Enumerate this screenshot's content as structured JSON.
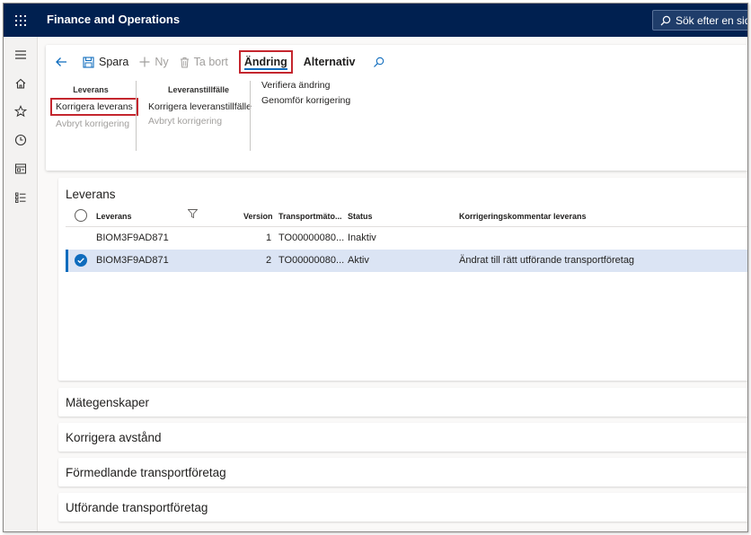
{
  "app": {
    "title": "Finance and Operations",
    "search_placeholder": "Sök efter en sida"
  },
  "nav": {
    "icons": [
      "hamburger-icon",
      "home-icon",
      "star-icon",
      "clock-icon",
      "workspace-icon",
      "list-icon"
    ]
  },
  "action_pane": {
    "save": "Spara",
    "new": "Ny",
    "delete": "Ta bort",
    "tabs": [
      "Ändring",
      "Alternativ"
    ],
    "active_tab": "Ändring",
    "groups": {
      "leverans": {
        "title": "Leverans",
        "items": [
          "Korrigera leverans",
          "Avbryt korrigering"
        ]
      },
      "leveranstillfalle": {
        "title": "Leveranstillfälle",
        "items": [
          "Korrigera leveranstillfälle",
          "Avbryt korrigering"
        ]
      },
      "ovrigt": {
        "items": [
          "Verifiera ändring",
          "Genomför korrigering"
        ]
      }
    }
  },
  "leverans_card": {
    "title": "Leverans",
    "columns": [
      "Leverans",
      "Version",
      "Transportmäto...",
      "Status",
      "Korrigeringskommentar leverans"
    ],
    "rows": [
      {
        "leverans": "BIOM3F9AD871",
        "version": "1",
        "transport": "TO00000080...",
        "status": "Inaktiv",
        "comment": "",
        "selected": false
      },
      {
        "leverans": "BIOM3F9AD871",
        "version": "2",
        "transport": "TO00000080...",
        "status": "Aktiv",
        "comment": "Ändrat till rätt utförande transportföretag",
        "selected": true
      }
    ]
  },
  "sections": [
    "Mätegenskaper",
    "Korrigera avstånd",
    "Förmedlande transportföretag",
    "Utförande transportföretag"
  ],
  "colors": {
    "topbar": "#002050",
    "accent": "#0f6cbd",
    "highlight": "#c4262e",
    "selected_row": "#dbe4f4"
  }
}
